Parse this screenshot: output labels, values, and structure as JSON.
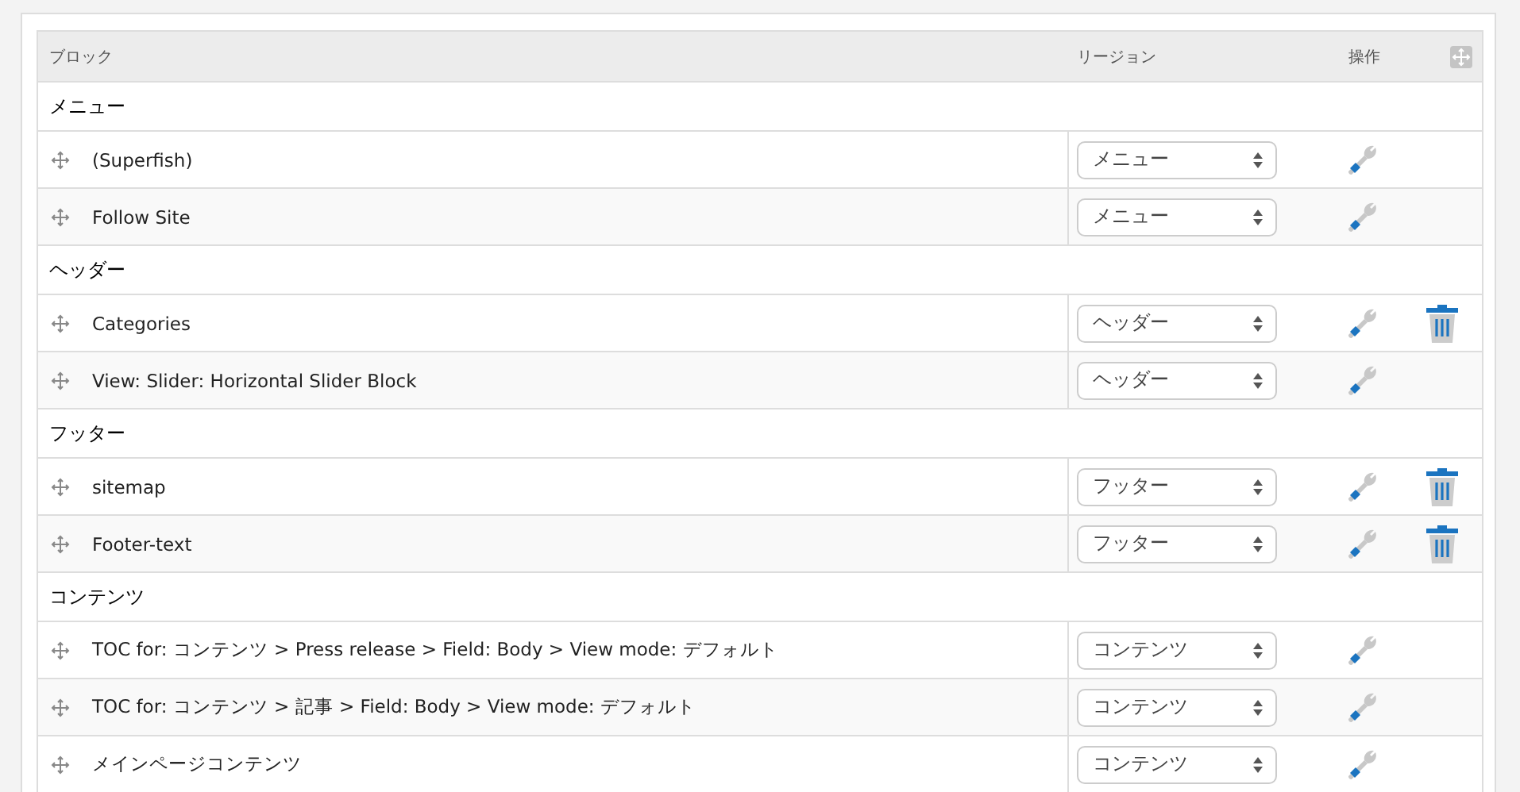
{
  "table": {
    "columns": [
      "ブロック",
      "リージョン",
      "操作"
    ],
    "regions": [
      {
        "name": "メニュー",
        "blocks": [
          {
            "title": "(Superfish)",
            "region": "メニュー",
            "deletable": false
          },
          {
            "title": "Follow Site",
            "region": "メニュー",
            "deletable": false
          }
        ]
      },
      {
        "name": "ヘッダー",
        "blocks": [
          {
            "title": "Categories",
            "region": "ヘッダー",
            "deletable": true
          },
          {
            "title": "View: Slider: Horizontal Slider Block",
            "region": "ヘッダー",
            "deletable": false
          }
        ]
      },
      {
        "name": "フッター",
        "blocks": [
          {
            "title": "sitemap",
            "region": "フッター",
            "deletable": true
          },
          {
            "title": "Footer-text",
            "region": "フッター",
            "deletable": true
          }
        ]
      },
      {
        "name": "コンテンツ",
        "blocks": [
          {
            "title": "TOC for: コンテンツ > Press release > Field: Body > View mode: デフォルト",
            "region": "コンテンツ",
            "deletable": false
          },
          {
            "title": "TOC for: コンテンツ > 記事 > Field: Body > View mode: デフォルト",
            "region": "コンテンツ",
            "deletable": false
          },
          {
            "title": "メインページコンテンツ",
            "region": "コンテンツ",
            "deletable": false
          }
        ]
      }
    ]
  }
}
